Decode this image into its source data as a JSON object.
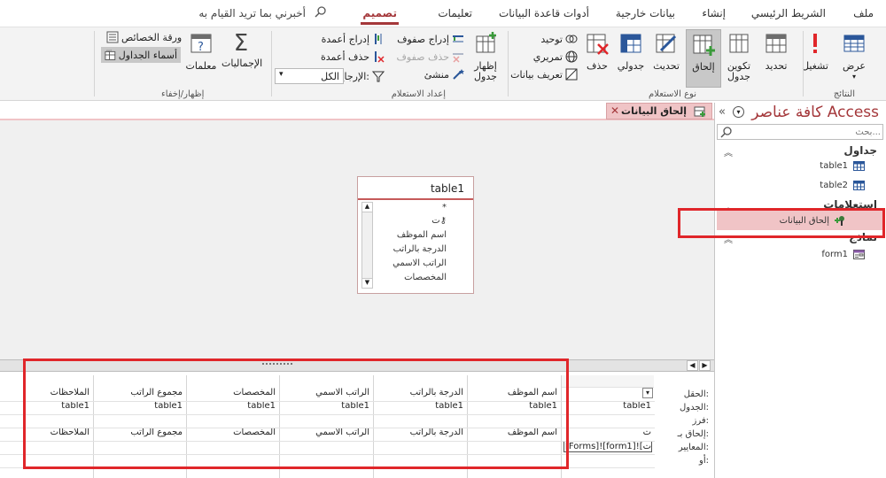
{
  "ribbon_tabs": {
    "file": "ملف",
    "home": "الشريط الرئيسي",
    "create": "إنشاء",
    "external_data": "بيانات خارجية",
    "db_tools": "أدوات قاعدة البيانات",
    "help": "تعليمات",
    "design": "تصميم",
    "tell_me": "أخبرني بما تريد القيام به"
  },
  "ribbon": {
    "results": {
      "label": "النتائج",
      "view": "عرض",
      "run": "تشغيل"
    },
    "query_type": {
      "label": "نوع الاستعلام",
      "select": "تحديد",
      "make_table": "تكوين جدول",
      "append": "إلحاق",
      "update": "تحديث",
      "crosstab": "جدولي",
      "delete": "حذف",
      "union": "توحيد",
      "pass_through": "تمريري",
      "data_definition": "تعريف بيانات"
    },
    "query_setup": {
      "label": "إعداد الاستعلام",
      "show_table": "إظهار جدول",
      "insert_rows": "إدراج صفوف",
      "delete_rows": "حذف صفوف",
      "builder": "منشئ",
      "insert_columns": "إدراج أعمدة",
      "delete_columns": "حذف أعمدة",
      "return_label": "الإرجاع:",
      "return_value": "الكل"
    },
    "show_hide": {
      "label": "إظهار/إخفاء",
      "totals": "الإجماليات",
      "parameters": "معلمات",
      "property_sheet": "ورقة الخصائص",
      "table_names": "أسماء الجداول"
    }
  },
  "document": {
    "tab_title": "إلحاق البيانات",
    "table_box": {
      "title": "table1",
      "fields": [
        "*",
        "ت",
        "اسم الموظف",
        "الدرجة بالراتب",
        "الراتب الاسمي",
        "المخصصات"
      ]
    },
    "grid": {
      "row_labels": [
        "الحقل:",
        "الجدول:",
        "فرز:",
        "إلحاق بـ:",
        "المعايير:",
        "أو:"
      ],
      "columns": [
        {
          "field": "",
          "table": "table1",
          "append": "ت",
          "criteria": "[Forms]![form1]![ت]"
        },
        {
          "field": "اسم الموظف",
          "table": "table1",
          "append": "اسم الموظف",
          "criteria": ""
        },
        {
          "field": "الدرجة بالراتب",
          "table": "table1",
          "append": "الدرجة بالراتب",
          "criteria": ""
        },
        {
          "field": "الراتب الاسمي",
          "table": "table1",
          "append": "الراتب الاسمي",
          "criteria": ""
        },
        {
          "field": "المخصصات",
          "table": "table1",
          "append": "المخصصات",
          "criteria": ""
        },
        {
          "field": "مجموع الراتب",
          "table": "table1",
          "append": "مجموع الراتب",
          "criteria": ""
        },
        {
          "field": "الملاحظات",
          "table": "table1",
          "append": "الملاحظات",
          "criteria": ""
        }
      ]
    }
  },
  "nav": {
    "title": "كافة عناصر Access",
    "search_placeholder": "بحث...",
    "sections": {
      "tables": "جداول",
      "queries": "استعلامات",
      "forms": "نماذج"
    },
    "tables": [
      "table1",
      "table2"
    ],
    "queries": [
      "إلحاق البيانات"
    ],
    "forms": [
      "form1"
    ]
  },
  "colors": {
    "accent": "#a4373a",
    "highlight_box": "#e0262a"
  }
}
